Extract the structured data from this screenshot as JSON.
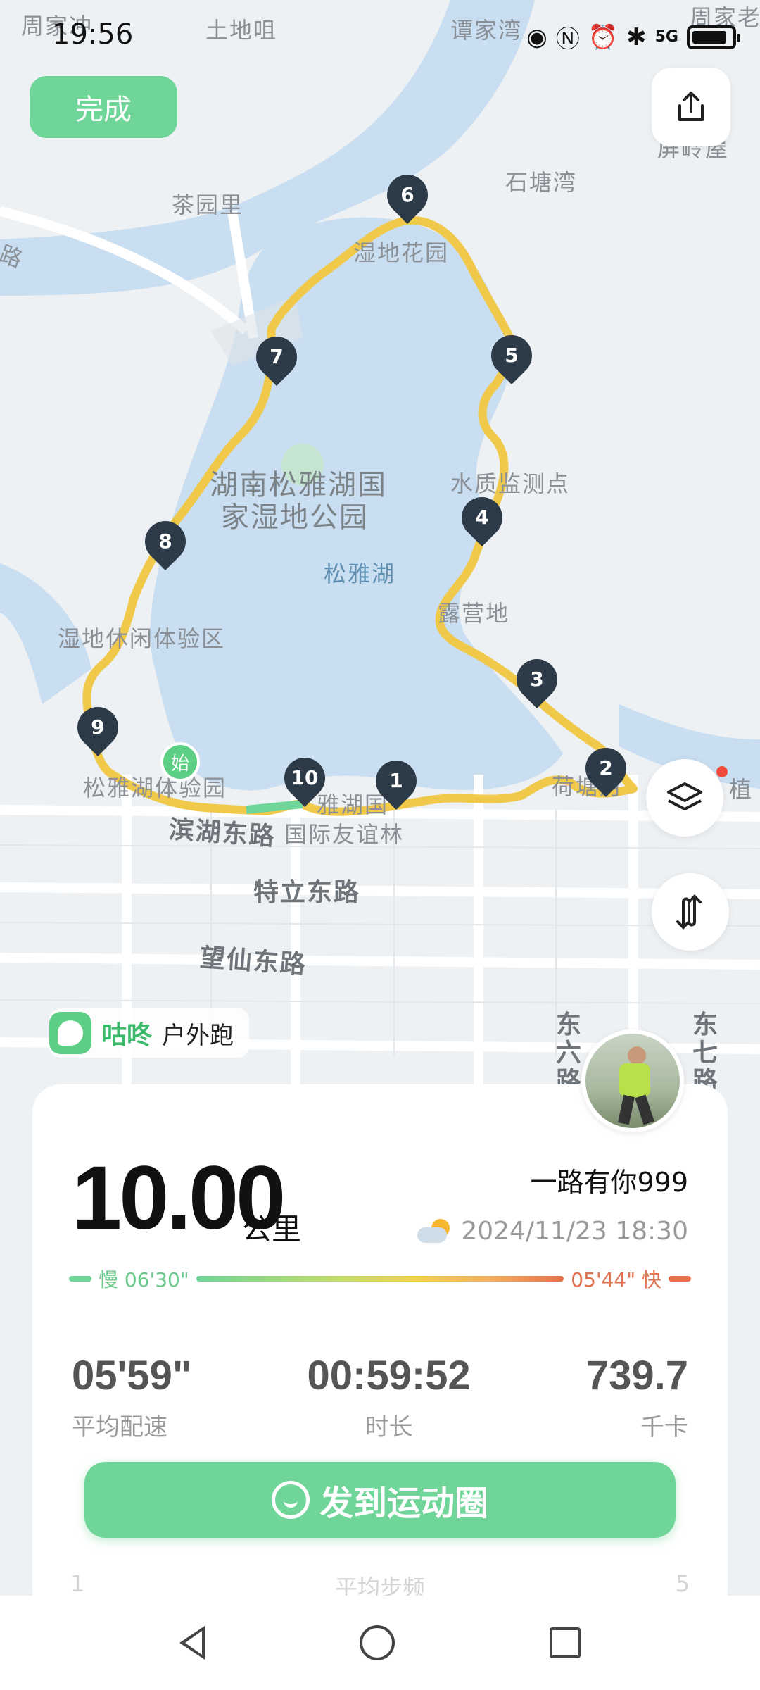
{
  "status_bar": {
    "time": "19:56",
    "network": "5G"
  },
  "map": {
    "labels": {
      "l1": "周家冲",
      "l2": "土地咀",
      "l3": "谭家湾",
      "l4": "周家老",
      "l5": "屏岭屋",
      "l6": "石塘湾",
      "l7": "茶园里",
      "l8": "湿地花园",
      "l9": "路",
      "l10": "湖南松雅湖国",
      "l11": "家湿地公园",
      "l12": "水质监测点",
      "l13": "松雅湖",
      "l14": "露营地",
      "l15": "湿地休闲体验区",
      "l16": "松雅湖体验园",
      "l17": "雅湖国",
      "l18": "国际友谊林",
      "l19": "滨湖东路",
      "l20": "特立东路",
      "l21": "望仙东路",
      "l22": "东六路",
      "l23": "东七路",
      "l24": "植",
      "l25": "荷塘月"
    },
    "markers": [
      "1",
      "2",
      "3",
      "4",
      "5",
      "6",
      "7",
      "8",
      "9",
      "10"
    ],
    "start_label": "始",
    "route_color": "#f0c94a"
  },
  "top": {
    "done": "完成"
  },
  "brand": {
    "name": "咕咚",
    "type": "户外跑"
  },
  "card": {
    "distance": "10.00",
    "unit": "公里",
    "nickname": "一路有你999",
    "datetime": "2024/11/23 18:30",
    "pace_slow": "慢 06'30\"",
    "pace_fast": "05'44\" 快",
    "stats": [
      {
        "value": "05'59\"",
        "label": "平均配速"
      },
      {
        "value": "00:59:52",
        "label": "时长"
      },
      {
        "value": "739.7",
        "label": "千卡"
      }
    ],
    "hidden_row": {
      "a": "1",
      "b": "平均步频",
      "c": "5"
    }
  },
  "post_button": "发到运动圈",
  "colors": {
    "accent": "#6fd598",
    "route": "#f0c94a",
    "lake": "#c9def0"
  }
}
